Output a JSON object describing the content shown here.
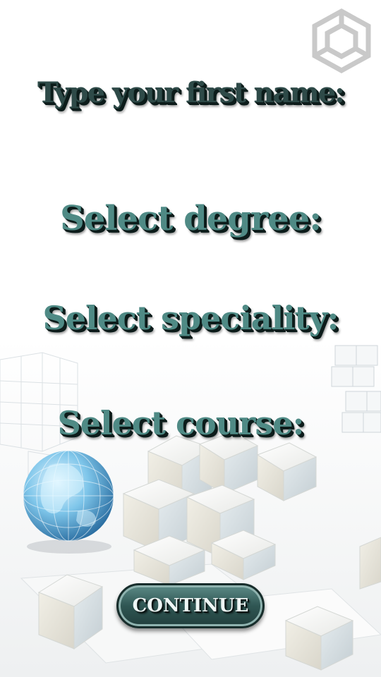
{
  "form": {
    "first_name_label": "Type your first name:",
    "degree_label": "Select degree:",
    "speciality_label": "Select speciality:",
    "course_label": "Select course:"
  },
  "actions": {
    "continue_label": "CONTINUE"
  },
  "icons": {
    "logo": "hexagon-logo-icon",
    "globe": "globe-icon",
    "cubes": "cubes-decoration"
  },
  "colors": {
    "label_dark": "#2e4a48",
    "label_teal": "#4f8a85",
    "button": "#2f5653"
  }
}
